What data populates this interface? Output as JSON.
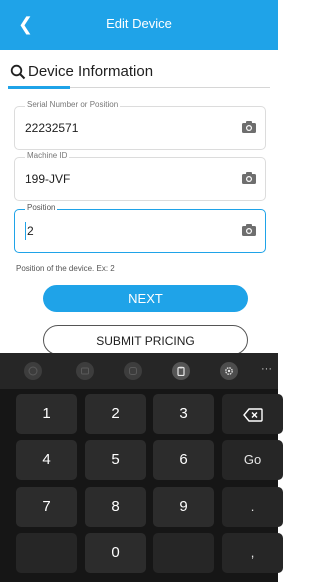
{
  "appbar": {
    "title": "Edit Device"
  },
  "section": {
    "title": "Device Information"
  },
  "fields": [
    {
      "label": "Serial Number or Position",
      "value": "22232571"
    },
    {
      "label": "Machine ID",
      "value": "199-JVF"
    },
    {
      "label": "Position",
      "value": "2"
    }
  ],
  "hint": "Position of the device. Ex: 2",
  "buttons": {
    "next": "NEXT",
    "submit": "SUBMIT PRICING"
  },
  "keyboard": {
    "keys": [
      "1",
      "2",
      "3",
      "4",
      "5",
      "6",
      "Go",
      "7",
      "8",
      "9",
      ".",
      "0",
      ","
    ],
    "more": "···"
  },
  "colors": {
    "accent": "#1fa3e8",
    "keyboard": "#161616",
    "key": "#2c2c2c"
  }
}
